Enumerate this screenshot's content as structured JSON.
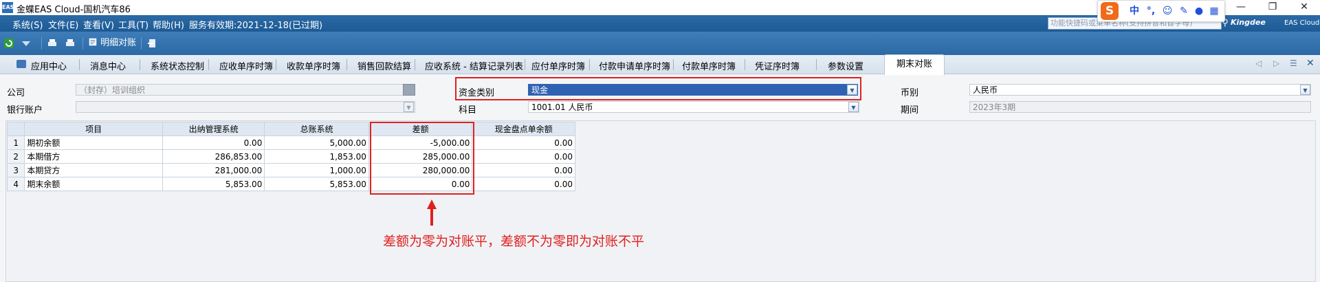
{
  "window": {
    "title": "金蝶EAS Cloud-国机汽车86",
    "logo_text": "EAS"
  },
  "menu": {
    "items": [
      "系统(S)",
      "文件(E)",
      "查看(V)",
      "工具(T)",
      "帮助(H)",
      "服务有效期:2021-12-18(已过期)"
    ],
    "search_placeholder": "功能快捷码或菜单名称(支持拼音和首字母)",
    "brand": "Kingdee",
    "brand_sub": "EAS Cloud"
  },
  "ime": {
    "logo": "S",
    "lang": "中"
  },
  "toolbar": {
    "detail_reconcile_label": "明细对账"
  },
  "tabs": [
    {
      "label": "应用中心"
    },
    {
      "label": "消息中心"
    },
    {
      "label": "系统状态控制"
    },
    {
      "label": "应收单序时簿"
    },
    {
      "label": "收款单序时簿"
    },
    {
      "label": "销售回款结算"
    },
    {
      "label": "应收系统 - 结算记录列表"
    },
    {
      "label": "应付单序时簿"
    },
    {
      "label": "付款申请单序时簿"
    },
    {
      "label": "付款单序时簿"
    },
    {
      "label": "凭证序时簿"
    },
    {
      "label": "参数设置"
    }
  ],
  "active_tab": "期末对账",
  "form": {
    "company_label": "公司",
    "company_value": "（封存）培训组织",
    "bank_label": "银行账户",
    "bank_value": "",
    "fund_type_label": "资金类别",
    "fund_type_value": "现金",
    "subject_label": "科目",
    "subject_value": "1001.01 人民币",
    "currency_label": "币别",
    "currency_value": "人民币",
    "period_label": "期间",
    "period_value": "2023年3期"
  },
  "grid": {
    "headers": [
      "项目",
      "出纳管理系统",
      "总账系统",
      "差额",
      "现金盘点单余额"
    ],
    "rows": [
      {
        "no": "1",
        "item": "期初余额",
        "cashier": "0.00",
        "ledger": "5,000.00",
        "diff": "-5,000.00",
        "count": "0.00"
      },
      {
        "no": "2",
        "item": "本期借方",
        "cashier": "286,853.00",
        "ledger": "1,853.00",
        "diff": "285,000.00",
        "count": "0.00"
      },
      {
        "no": "3",
        "item": "本期贷方",
        "cashier": "281,000.00",
        "ledger": "1,000.00",
        "diff": "280,000.00",
        "count": "0.00"
      },
      {
        "no": "4",
        "item": "期末余额",
        "cashier": "5,853.00",
        "ledger": "5,853.00",
        "diff": "0.00",
        "count": "0.00"
      }
    ]
  },
  "annotation": {
    "note": "差额为零为对账平，差额不为零即为对账不平"
  },
  "colors": {
    "accent": "#2b6aa6",
    "highlight_red": "#e02020",
    "selected_field": "#2f62b3"
  }
}
